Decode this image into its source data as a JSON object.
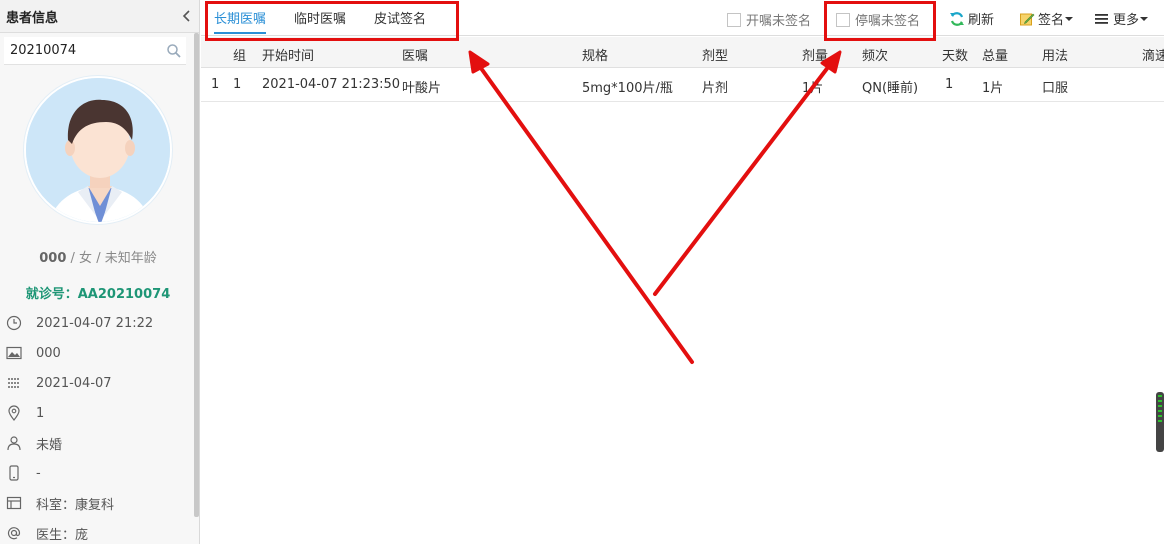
{
  "sidebar": {
    "title": "患者信息",
    "search_value": "20210074",
    "patient": {
      "code": "000",
      "separator1": " / ",
      "gender": "女",
      "separator2": " / ",
      "age": "未知年龄"
    },
    "visit_label": "就诊号：",
    "visit_number": "AA20210074",
    "info": [
      {
        "icon": "clock-icon",
        "text": "2021-04-07 21:22"
      },
      {
        "icon": "image-icon",
        "text": "000"
      },
      {
        "icon": "calendar-icon",
        "text": "2021-04-07"
      },
      {
        "icon": "location-icon",
        "text": "1"
      },
      {
        "icon": "person-icon",
        "text": "未婚"
      },
      {
        "icon": "phone-icon",
        "text": "-"
      },
      {
        "icon": "department-icon",
        "text": "科室：康复科"
      },
      {
        "icon": "at-icon",
        "text": "医生：庞"
      }
    ]
  },
  "toolbar": {
    "tabs": [
      {
        "label": "长期医嘱",
        "active": true
      },
      {
        "label": "临时医嘱",
        "active": false
      },
      {
        "label": "皮试签名",
        "active": false
      }
    ],
    "checkbox_unsigned_start": "开嘱未签名",
    "checkbox_unsigned_stop": "停嘱未签名",
    "refresh_label": "刷新",
    "sign_label": "签名",
    "more_label": "更多"
  },
  "grid": {
    "columns": [
      "组",
      "开始时间",
      "医嘱",
      "规格",
      "剂型",
      "剂量",
      "频次",
      "天数",
      "总量",
      "用法",
      "滴速"
    ],
    "rows": [
      {
        "rownum": "1",
        "group": "1",
        "start_time": "2021-04-07 21:23:50",
        "order": "叶酸片",
        "spec": "5mg*100片/瓶",
        "form": "片剂",
        "dose": "1片",
        "frequency": "QN(睡前)",
        "days": "1",
        "total": "1片",
        "usage": "口服"
      }
    ]
  },
  "colors": {
    "accent": "#2a8fd6",
    "visit_green": "#1e9676",
    "annotation_red": "#e30f0f"
  }
}
